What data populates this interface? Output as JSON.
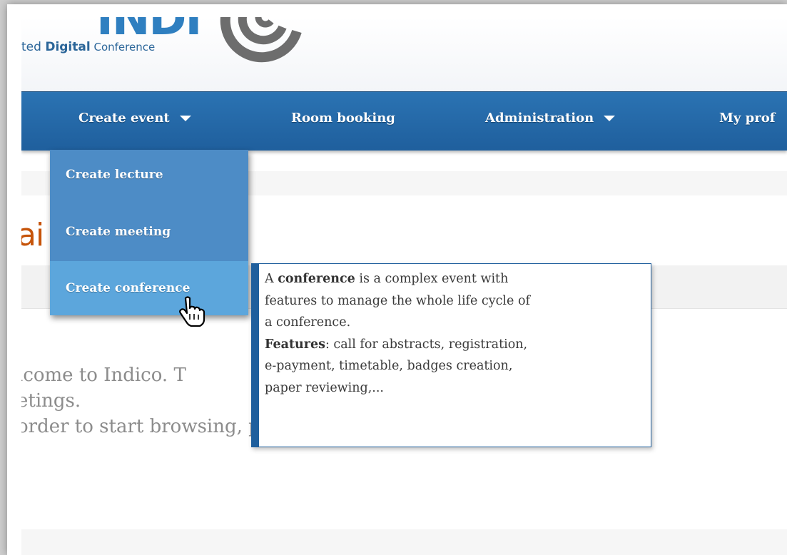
{
  "logo": {
    "text_prefix": "ted ",
    "text_bold": "Digital",
    "text_suffix": " Conference",
    "big": "INDI"
  },
  "nav": {
    "items": [
      {
        "label": "Create event",
        "has_caret": true
      },
      {
        "label": "Room booking",
        "has_caret": false
      },
      {
        "label": "Administration",
        "has_caret": true
      },
      {
        "label": "My prof",
        "has_caret": false
      }
    ]
  },
  "dropdown": {
    "items": [
      {
        "label": "Create lecture"
      },
      {
        "label": "Create meeting"
      },
      {
        "label": "Create conference"
      }
    ],
    "active_index": 2
  },
  "page": {
    "title_visible": "ai          ries",
    "welcome_lines": [
      "lcome to Indico. T                                               ge complex",
      "etings.",
      "order to start browsing, please select one of the categories below"
    ]
  },
  "tooltip": {
    "line1_pre": "A ",
    "line1_bold": "conference",
    "line1_post": " is a complex event with",
    "line2": "features to manage the whole life cycle of",
    "line3": "a conference.",
    "line4_bold": "Features",
    "line4_post": ": call for abstracts, registration,",
    "line5": "e-payment, timetable, badges creation,",
    "line6": "paper reviewing,..."
  },
  "colors": {
    "nav_bg": "#2b73b3",
    "dropdown_bg": "#4d8cc6",
    "dropdown_active": "#5ca6dc",
    "title_orange": "#c6540a",
    "tooltip_border": "#1f5f9d"
  },
  "icons": {
    "cursor": "hand-pointer-icon",
    "caret": "caret-down-icon"
  }
}
